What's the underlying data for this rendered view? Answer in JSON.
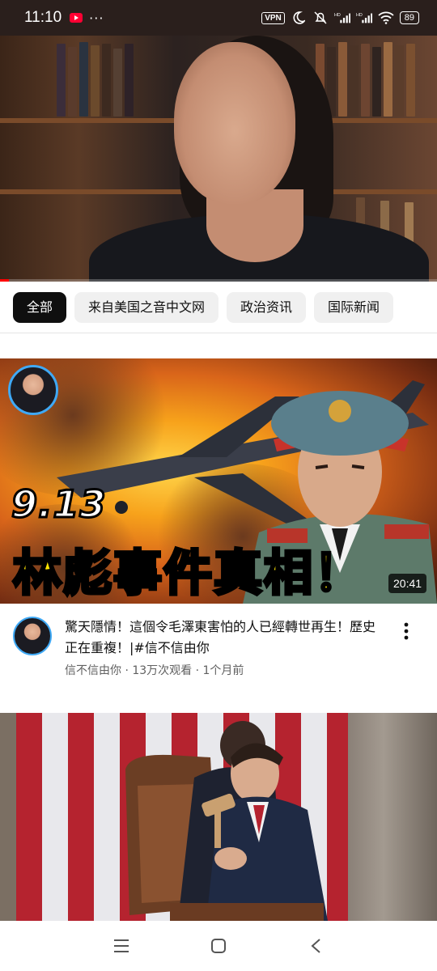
{
  "status_bar": {
    "time": "11:10",
    "dots": "···",
    "vpn": "VPN",
    "battery": "89",
    "signal_hd": "HD"
  },
  "chips": [
    {
      "label": "全部",
      "active": true
    },
    {
      "label": "来自美国之音中文网",
      "active": false
    },
    {
      "label": "政治资讯",
      "active": false
    },
    {
      "label": "国际新闻",
      "active": false
    }
  ],
  "video1": {
    "thumb_line1": "9.13",
    "thumb_line2": "林彪事件真相！",
    "duration": "20:41",
    "title": "驚天隱情！這個令毛澤東害怕的人已經轉世再生！歷史正在重複！|#信不信由你",
    "channel": "信不信由你",
    "views": "13万次观看",
    "age": "1个月前",
    "subline": "信不信由你 · 13万次观看 · 1个月前"
  },
  "player": {
    "progress": 0.02
  },
  "colors": {
    "accent": "#ff0000",
    "chip_active": "#0f0f0f",
    "thumb_title": "#ffe500"
  },
  "icons": [
    "youtube-icon",
    "moon-icon",
    "mute-icon",
    "signal-icon",
    "wifi-icon",
    "battery-icon",
    "more-vert-icon",
    "menu-icon",
    "home-icon",
    "back-icon"
  ]
}
